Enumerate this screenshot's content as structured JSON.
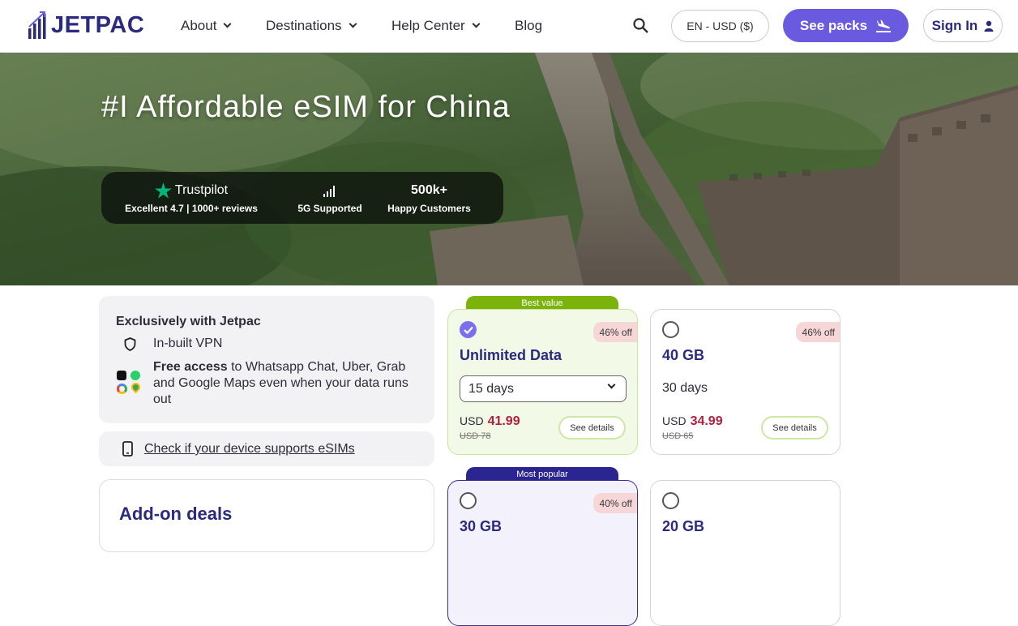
{
  "header": {
    "logo": "JETPAC",
    "nav": [
      {
        "label": "About",
        "dropdown": true
      },
      {
        "label": "Destinations",
        "dropdown": true
      },
      {
        "label": "Help Center",
        "dropdown": true
      },
      {
        "label": "Blog",
        "dropdown": false
      }
    ],
    "lang_currency": "EN - USD ($)",
    "see_packs": "See packs",
    "sign_in": "Sign In"
  },
  "hero": {
    "title": "#I Affordable eSIM for China",
    "stats": [
      {
        "top": "Trustpilot",
        "bottom": "Excellent 4.7 | 1000+ reviews",
        "icon": "star-icon"
      },
      {
        "top": "",
        "bottom": "5G Supported",
        "icon": "signal-icon"
      },
      {
        "top": "500k+",
        "bottom": "Happy Customers",
        "icon": ""
      }
    ]
  },
  "exclusive": {
    "title": "Exclusively with Jetpac",
    "vpn": "In-built VPN",
    "free_strong": "Free access",
    "free_rest": " to Whatsapp Chat, Uber, Grab and Google Maps even when your data runs out"
  },
  "device_check": "Check if your device supports eSIMs",
  "addon_title": "Add-on deals",
  "plans": [
    {
      "tag": "Best value",
      "name": "Unlimited Data",
      "discount": "46% off",
      "duration": "15 days",
      "currency": "USD",
      "price": "41.99",
      "old_price": "USD 78",
      "details": "See details",
      "selected": true
    },
    {
      "tag": "",
      "name": "40 GB",
      "discount": "46% off",
      "duration": "30 days",
      "currency": "USD",
      "price": "34.99",
      "old_price": "USD 65",
      "details": "See details",
      "selected": false
    },
    {
      "tag": "Most popular",
      "name": "30 GB",
      "discount": "40% off",
      "selected": false
    },
    {
      "tag": "",
      "name": "20 GB",
      "discount": "",
      "selected": false
    }
  ],
  "colors": {
    "brand": "#2b2a7e",
    "accent": "#6a5ae0",
    "price": "#b0203e",
    "best_value": "#7cb30b",
    "most_popular": "#2a2590",
    "discount_badge": "#f8d9d9"
  }
}
